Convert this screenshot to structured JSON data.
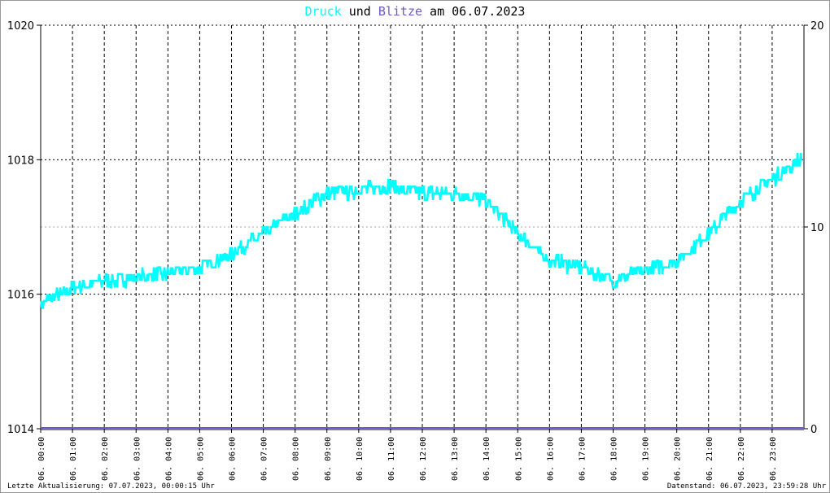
{
  "chart_data": {
    "type": "line",
    "title": {
      "part1": "Druck",
      "part2": " und ",
      "part3": "Blitze",
      "part4": " am 06.07.2023"
    },
    "colors": {
      "druck": "#00ffff",
      "blitze": "#6a5acd",
      "grid": "#000000"
    },
    "y_left": {
      "range": [
        1014,
        1020
      ],
      "ticks": [
        "1014",
        "1016",
        "1018",
        "1020"
      ]
    },
    "y_right": {
      "range": [
        0,
        20
      ],
      "ticks": [
        "0",
        "10",
        "20"
      ]
    },
    "x_ticks": [
      "06. 00:00",
      "06. 01:00",
      "06. 02:00",
      "06. 03:00",
      "06. 04:00",
      "06. 05:00",
      "06. 06:00",
      "06. 07:00",
      "06. 08:00",
      "06. 09:00",
      "06. 10:00",
      "06. 11:00",
      "06. 12:00",
      "06. 13:00",
      "06. 14:00",
      "06. 15:00",
      "06. 16:00",
      "06. 17:00",
      "06. 18:00",
      "06. 19:00",
      "06. 20:00",
      "06. 21:00",
      "06. 22:00",
      "06. 23:00"
    ],
    "series": [
      {
        "name": "Druck",
        "axis": "left",
        "hourly_values": [
          1015.85,
          1016.1,
          1016.2,
          1016.25,
          1016.3,
          1016.4,
          1016.6,
          1016.9,
          1017.2,
          1017.5,
          1017.55,
          1017.6,
          1017.5,
          1017.5,
          1017.4,
          1016.9,
          1016.5,
          1016.4,
          1016.2,
          1016.35,
          1016.5,
          1016.9,
          1017.4,
          1017.7,
          1018.05
        ]
      },
      {
        "name": "Blitze",
        "axis": "right",
        "hourly_values": [
          0,
          0,
          0,
          0,
          0,
          0,
          0,
          0,
          0,
          0,
          0,
          0,
          0,
          0,
          0,
          0,
          0,
          0,
          0,
          0,
          0,
          0,
          0,
          0,
          0
        ]
      }
    ]
  },
  "footer": {
    "left": "Letzte Aktualisierung: 07.07.2023, 00:00:15 Uhr",
    "right": "Datenstand: 06.07.2023, 23:59:28 Uhr"
  }
}
